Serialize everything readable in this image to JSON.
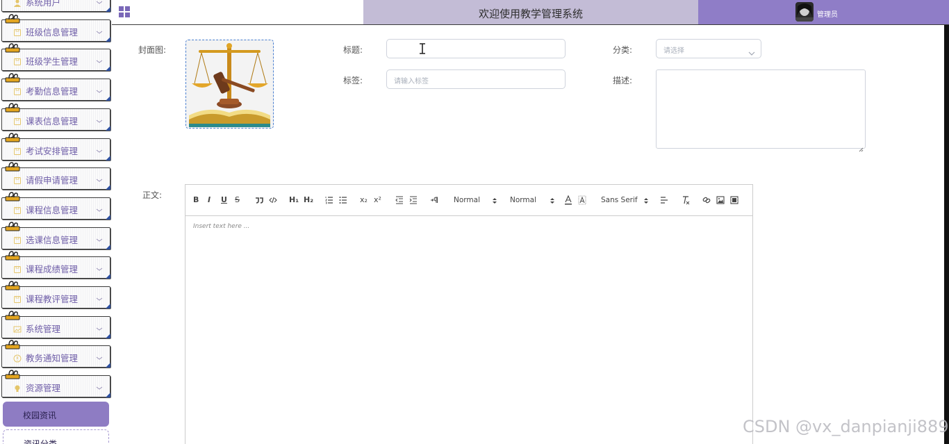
{
  "header": {
    "system_title": "欢迎使用教学管理系统",
    "user_name": "管理员"
  },
  "sidebar": {
    "items": [
      {
        "label": "系统用户",
        "icon": "user-icon"
      },
      {
        "label": "班级信息管理",
        "icon": "folder-icon"
      },
      {
        "label": "班级学生管理",
        "icon": "folder-icon"
      },
      {
        "label": "考勤信息管理",
        "icon": "folder-icon"
      },
      {
        "label": "课表信息管理",
        "icon": "folder-icon"
      },
      {
        "label": "考试安排管理",
        "icon": "folder-icon"
      },
      {
        "label": "请假申请管理",
        "icon": "folder-icon"
      },
      {
        "label": "课程信息管理",
        "icon": "folder-icon"
      },
      {
        "label": "选课信息管理",
        "icon": "folder-icon"
      },
      {
        "label": "课程成绩管理",
        "icon": "folder-icon"
      },
      {
        "label": "课程教评管理",
        "icon": "folder-icon"
      },
      {
        "label": "系统管理",
        "icon": "image-icon"
      },
      {
        "label": "教务通知管理",
        "icon": "info-icon"
      },
      {
        "label": "资源管理",
        "icon": "bulb-icon"
      }
    ],
    "sub_active": "校园资讯",
    "sub_next": "资讯分类"
  },
  "form": {
    "cover_label": "封面图:",
    "title_label": "标题:",
    "title_value": "",
    "category_label": "分类:",
    "category_placeholder": "请选择",
    "tags_label": "标签:",
    "tags_placeholder": "请输入标签",
    "desc_label": "描述:",
    "body_label": "正文:"
  },
  "editor": {
    "bold": "B",
    "italic": "I",
    "underline": "U",
    "strike": "S",
    "h1": "H₁",
    "h2": "H₂",
    "sub": "x₂",
    "sup": "x²",
    "size_picker": "Normal",
    "header_picker": "Normal",
    "font_picker": "Sans Serif",
    "placeholder": "Insert text here ..."
  },
  "watermark": "CSDN @vx_danpianji889",
  "colors": {
    "accent": "#8e7cc3",
    "title_band": "#c3bcd6",
    "user_band": "#8f7dc7",
    "menu_text": "#6f5ea8"
  }
}
